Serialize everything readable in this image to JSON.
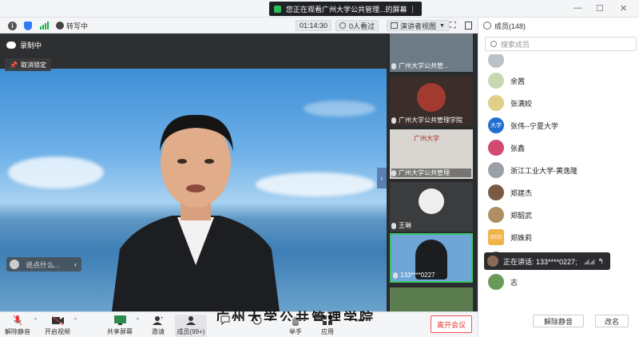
{
  "banner": {
    "text": "您正在观看广州大学公共管理...的屏幕"
  },
  "toolbar": {
    "transcribe": "转写中",
    "timer": "01:14:30",
    "viewers": "0人看过",
    "view_mode": "演讲者视图"
  },
  "main": {
    "recording": "录制中",
    "unlock": "取消锁定",
    "comment_placeholder": "说点什么..."
  },
  "thumbs": [
    {
      "label": "广州大学公共管..."
    },
    {
      "label": "广州大学公共管理学院"
    },
    {
      "label": "广州大学公共管理"
    },
    {
      "label": "王琳"
    },
    {
      "label": "133****0227"
    },
    {
      "label": ""
    }
  ],
  "thumb_header": {
    "text": "广州大学"
  },
  "controls": [
    {
      "label": "解除静音",
      "icon": "mic-muted-icon"
    },
    {
      "label": "开启视频",
      "icon": "camera-off-icon"
    },
    {
      "label": "共享屏幕",
      "icon": "screen-share-icon"
    },
    {
      "label": "邀请",
      "icon": "invite-icon"
    },
    {
      "label": "成员(99+)",
      "icon": "members-icon"
    },
    {
      "label": "",
      "icon": "chat-icon"
    },
    {
      "label": "",
      "icon": "app-icon"
    },
    {
      "label": "举手",
      "icon": "raise-hand-icon"
    },
    {
      "label": "应用",
      "icon": "apps-icon"
    },
    {
      "label": "",
      "icon": "more-icon"
    }
  ],
  "leave_button": "离开会议",
  "watermark": "广州大学公共管理学院",
  "panel": {
    "title": "成员(148)",
    "search_placeholder": "搜索成员",
    "members": [
      {
        "name": "",
        "avatar": "#b9c3c9"
      },
      {
        "name": "余茜",
        "avatar": "#c9d6b2"
      },
      {
        "name": "张满姣",
        "avatar": "#e0cf8a"
      },
      {
        "name": "张伟--宁夏大学",
        "avatar": "#1f6fd1",
        "avatar_text": "大学"
      },
      {
        "name": "张鑫",
        "avatar": "#d24a6e"
      },
      {
        "name": "浙江工业大学-黄逸隆",
        "avatar": "#9aa0a6"
      },
      {
        "name": "郑建杰",
        "avatar": "#7a5a44"
      },
      {
        "name": "郑韶武",
        "avatar": "#b08e63"
      },
      {
        "name": "郑姝莉",
        "avatar": "#f0b34a",
        "avatar_text": "2022"
      },
      {
        "name": "",
        "avatar": "#666"
      },
      {
        "name": "志",
        "avatar": "#6a9a5a"
      }
    ],
    "speaking": "正在讲话: 133****0227;",
    "unmute_all": "解除静音",
    "rename": "改名"
  },
  "colors": {
    "accent": "#2f7bf5",
    "leave": "#e53935",
    "panel_bg": "#ffffff"
  }
}
